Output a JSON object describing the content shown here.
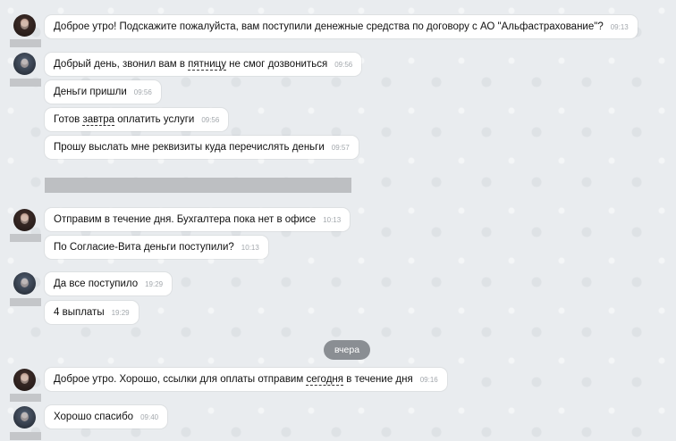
{
  "messages": [
    {
      "text_a": "Доброе утро! Подскажите пожалуйста, вам поступили денежные средства по договору с АО \"Альфастрахование\"?",
      "time": "09:13"
    },
    {
      "text_a": "Добрый день, звонил вам в ",
      "text_u": "пятницу",
      "text_b": " не смог дозвониться",
      "time": "09:56"
    },
    {
      "text_a": "Деньги пришли",
      "time": "09:56"
    },
    {
      "text_a": "Готов ",
      "text_u": "завтра",
      "text_b": " оплатить услуги",
      "time": "09:56"
    },
    {
      "text_a": "Прошу выслать мне реквизиты куда перечислять деньги",
      "time": "09:57"
    },
    {
      "text_a": "Отправим в течение дня. Бухгалтера пока нет в офисе",
      "time": "10:13"
    },
    {
      "text_a": "По Согласие-Вита деньги поступили?",
      "time": "10:13"
    },
    {
      "text_a": "Да все поступило",
      "time": "19:29"
    },
    {
      "text_a": "4 выплаты",
      "time": "19:29"
    },
    {
      "text_a": "Доброе утро. Хорошо, ссылки для оплаты отправим ",
      "text_u": "сегодня",
      "text_b": " в течение дня",
      "time": "09:16"
    },
    {
      "text_a": "Хорошо спасибо",
      "time": "09:40"
    }
  ],
  "date_separator": "вчера",
  "avatar_icons": {
    "agent": "woman-avatar-photo",
    "client": "man-avatar-photo"
  }
}
